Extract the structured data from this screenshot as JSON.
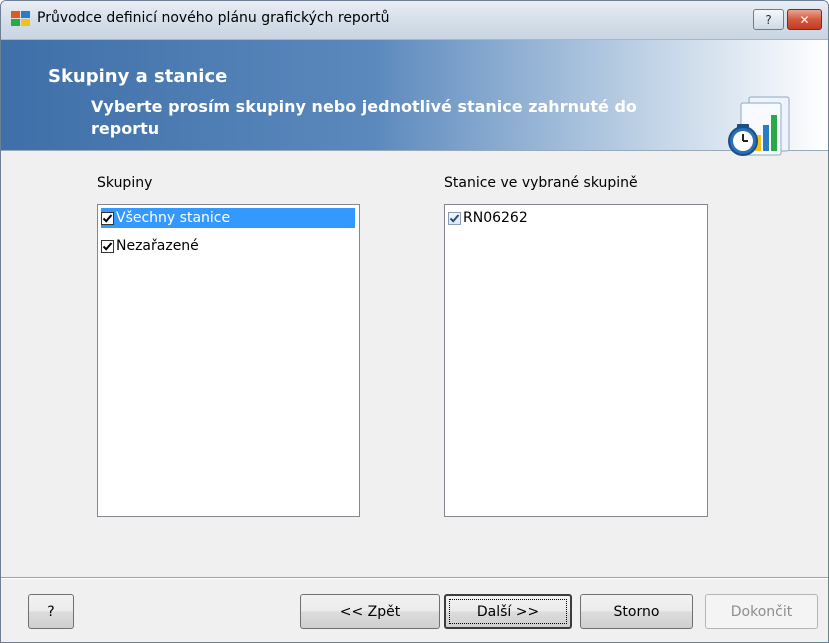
{
  "window": {
    "title": "Průvodce definicí nového plánu grafických reportů",
    "help_button": "?",
    "close_button": "✕"
  },
  "banner": {
    "title": "Skupiny a stanice",
    "subtitle": "Vyberte prosím skupiny nebo jednotlivé stanice zahrnuté do reportu"
  },
  "groups": {
    "label": "Skupiny",
    "items": [
      {
        "label": "Všechny stanice",
        "checked": true,
        "selected": true
      },
      {
        "label": "Nezařazené",
        "checked": true,
        "selected": false
      }
    ]
  },
  "stations": {
    "label": "Stanice ve vybrané skupině",
    "items": [
      {
        "label": "RN06262",
        "checked": true
      }
    ]
  },
  "footer": {
    "help_label": "?",
    "back_label": "<< Zpět",
    "next_label": "Další >>",
    "cancel_label": "Storno",
    "finish_label": "Dokončit"
  },
  "colors": {
    "banner_start": "#3f6fa8",
    "selection": "#3399ff",
    "close_button": "#c23a22"
  }
}
